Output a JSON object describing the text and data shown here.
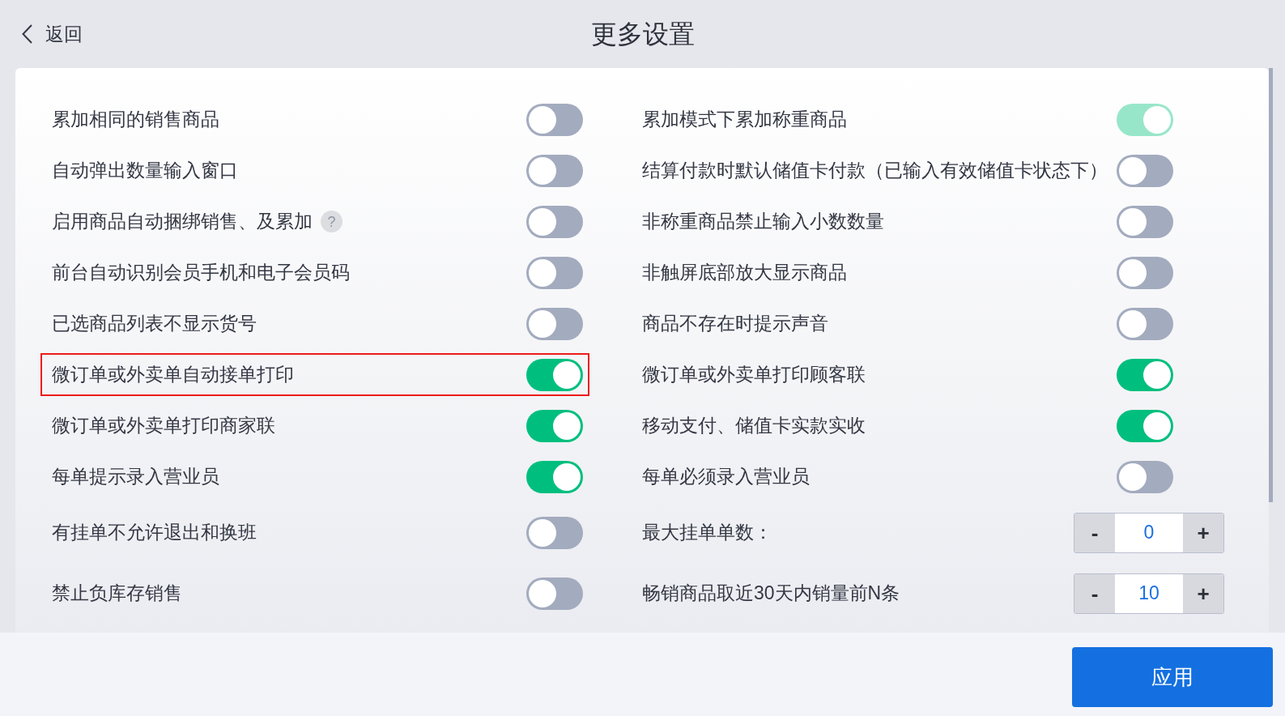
{
  "header": {
    "back_label": "返回",
    "title": "更多设置"
  },
  "settings": [
    {
      "kind": "toggle",
      "label": "累加相同的销售商品",
      "on": false,
      "disabled": false,
      "highlighted": false
    },
    {
      "kind": "toggle",
      "label": "累加模式下累加称重商品",
      "on": true,
      "disabled": true,
      "highlighted": false
    },
    {
      "kind": "toggle",
      "label": "自动弹出数量输入窗口",
      "on": false,
      "disabled": false,
      "highlighted": false
    },
    {
      "kind": "toggle",
      "label": "结算付款时默认储值卡付款（已输入有效储值卡状态下）",
      "on": false,
      "disabled": false,
      "highlighted": false
    },
    {
      "kind": "toggle",
      "label": "启用商品自动捆绑销售、及累加",
      "help": "?",
      "on": false,
      "disabled": false,
      "highlighted": false
    },
    {
      "kind": "toggle",
      "label": "非称重商品禁止输入小数数量",
      "on": false,
      "disabled": false,
      "highlighted": false
    },
    {
      "kind": "toggle",
      "label": "前台自动识别会员手机和电子会员码",
      "on": false,
      "disabled": false,
      "highlighted": false
    },
    {
      "kind": "toggle",
      "label": "非触屏底部放大显示商品",
      "on": false,
      "disabled": false,
      "highlighted": false
    },
    {
      "kind": "toggle",
      "label": "已选商品列表不显示货号",
      "on": false,
      "disabled": false,
      "highlighted": false
    },
    {
      "kind": "toggle",
      "label": "商品不存在时提示声音",
      "on": false,
      "disabled": false,
      "highlighted": false
    },
    {
      "kind": "toggle",
      "label": "微订单或外卖单自动接单打印",
      "on": true,
      "disabled": false,
      "highlighted": true
    },
    {
      "kind": "toggle",
      "label": "微订单或外卖单打印顾客联",
      "on": true,
      "disabled": false,
      "highlighted": false
    },
    {
      "kind": "toggle",
      "label": "微订单或外卖单打印商家联",
      "on": true,
      "disabled": false,
      "highlighted": false
    },
    {
      "kind": "toggle",
      "label": "移动支付、储值卡实款实收",
      "on": true,
      "disabled": false,
      "highlighted": false
    },
    {
      "kind": "toggle",
      "label": "每单提示录入营业员",
      "on": true,
      "disabled": false,
      "highlighted": false
    },
    {
      "kind": "toggle",
      "label": "每单必须录入营业员",
      "on": false,
      "disabled": false,
      "highlighted": false
    },
    {
      "kind": "toggle",
      "label": "有挂单不允许退出和换班",
      "on": false,
      "disabled": false,
      "highlighted": false
    },
    {
      "kind": "stepper",
      "label": "最大挂单单数：",
      "decrement": "-",
      "value": "0",
      "increment": "+",
      "disabled": false,
      "highlighted": false
    },
    {
      "kind": "toggle",
      "label": "禁止负库存销售",
      "on": false,
      "disabled": false,
      "highlighted": false
    },
    {
      "kind": "stepper",
      "label": "畅销商品取近30天内销量前N条",
      "decrement": "-",
      "value": "10",
      "increment": "+",
      "disabled": false,
      "highlighted": false
    }
  ],
  "apply_button": "应用"
}
